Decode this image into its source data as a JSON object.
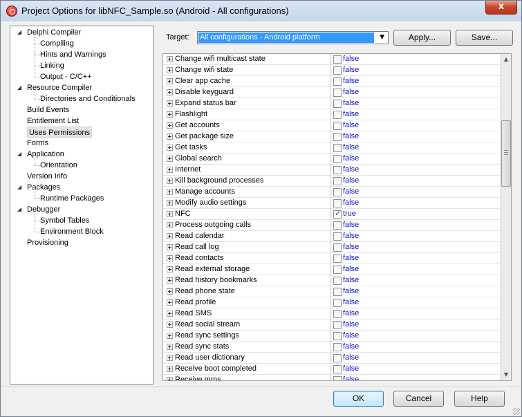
{
  "window": {
    "title": "Project Options for libNFC_Sample.so  (Android - All configurations)",
    "close_glyph": "x"
  },
  "tree": [
    {
      "label": "Delphi Compiler",
      "level": 0,
      "expanded": true
    },
    {
      "label": "Compiling",
      "level": 1
    },
    {
      "label": "Hints and Warnings",
      "level": 1
    },
    {
      "label": "Linking",
      "level": 1
    },
    {
      "label": "Output - C/C++",
      "level": 1
    },
    {
      "label": "Resource Compiler",
      "level": 0,
      "expanded": true
    },
    {
      "label": "Directories and Conditionals",
      "level": 1
    },
    {
      "label": "Build Events",
      "level": 0
    },
    {
      "label": "Entitlement List",
      "level": 0
    },
    {
      "label": "Uses Permissions",
      "level": 0,
      "selected": true
    },
    {
      "label": "Forms",
      "level": 0
    },
    {
      "label": "Application",
      "level": 0,
      "expanded": true
    },
    {
      "label": "Orientation",
      "level": 1
    },
    {
      "label": "Version Info",
      "level": 0
    },
    {
      "label": "Packages",
      "level": 0,
      "expanded": true
    },
    {
      "label": "Runtime Packages",
      "level": 1
    },
    {
      "label": "Debugger",
      "level": 0,
      "expanded": true
    },
    {
      "label": "Symbol Tables",
      "level": 1
    },
    {
      "label": "Environment Block",
      "level": 1
    },
    {
      "label": "Provisioning",
      "level": 0
    }
  ],
  "target": {
    "label": "Target:",
    "value": "All configurations - Android platform"
  },
  "buttons": {
    "apply": "Apply...",
    "save": "Save...",
    "ok": "OK",
    "cancel": "Cancel",
    "help": "Help"
  },
  "permissions": [
    {
      "name": "Change wifi multicast state",
      "value": "false",
      "checked": false
    },
    {
      "name": "Change wifi state",
      "value": "false",
      "checked": false
    },
    {
      "name": "Clear app cache",
      "value": "false",
      "checked": false
    },
    {
      "name": "Disable keyguard",
      "value": "false",
      "checked": false
    },
    {
      "name": "Expand status bar",
      "value": "false",
      "checked": false
    },
    {
      "name": "Flashlight",
      "value": "false",
      "checked": false
    },
    {
      "name": "Get accounts",
      "value": "false",
      "checked": false
    },
    {
      "name": "Get package size",
      "value": "false",
      "checked": false
    },
    {
      "name": "Get tasks",
      "value": "false",
      "checked": false
    },
    {
      "name": "Global search",
      "value": "false",
      "checked": false
    },
    {
      "name": "Internet",
      "value": "false",
      "checked": false
    },
    {
      "name": "Kill background processes",
      "value": "false",
      "checked": false
    },
    {
      "name": "Manage accounts",
      "value": "false",
      "checked": false
    },
    {
      "name": "Modify audio settings",
      "value": "false",
      "checked": false
    },
    {
      "name": "NFC",
      "value": "true",
      "checked": true
    },
    {
      "name": "Process outgoing calls",
      "value": "false",
      "checked": false
    },
    {
      "name": "Read calendar",
      "value": "false",
      "checked": false
    },
    {
      "name": "Read call log",
      "value": "false",
      "checked": false
    },
    {
      "name": "Read contacts",
      "value": "false",
      "checked": false
    },
    {
      "name": "Read external storage",
      "value": "false",
      "checked": false
    },
    {
      "name": "Read history bookmarks",
      "value": "false",
      "checked": false
    },
    {
      "name": "Read phone state",
      "value": "false",
      "checked": false
    },
    {
      "name": "Read profile",
      "value": "false",
      "checked": false
    },
    {
      "name": "Read SMS",
      "value": "false",
      "checked": false
    },
    {
      "name": "Read social stream",
      "value": "false",
      "checked": false
    },
    {
      "name": "Read sync settings",
      "value": "false",
      "checked": false
    },
    {
      "name": "Read sync stats",
      "value": "false",
      "checked": false
    },
    {
      "name": "Read user dictionary",
      "value": "false",
      "checked": false
    },
    {
      "name": "Receive boot completed",
      "value": "false",
      "checked": false
    },
    {
      "name": "Receive mms",
      "value": "false",
      "checked": false
    }
  ],
  "colors": {
    "value_text": "#1010c8",
    "selection": "#3399ff",
    "title_close": "#c94a31"
  }
}
